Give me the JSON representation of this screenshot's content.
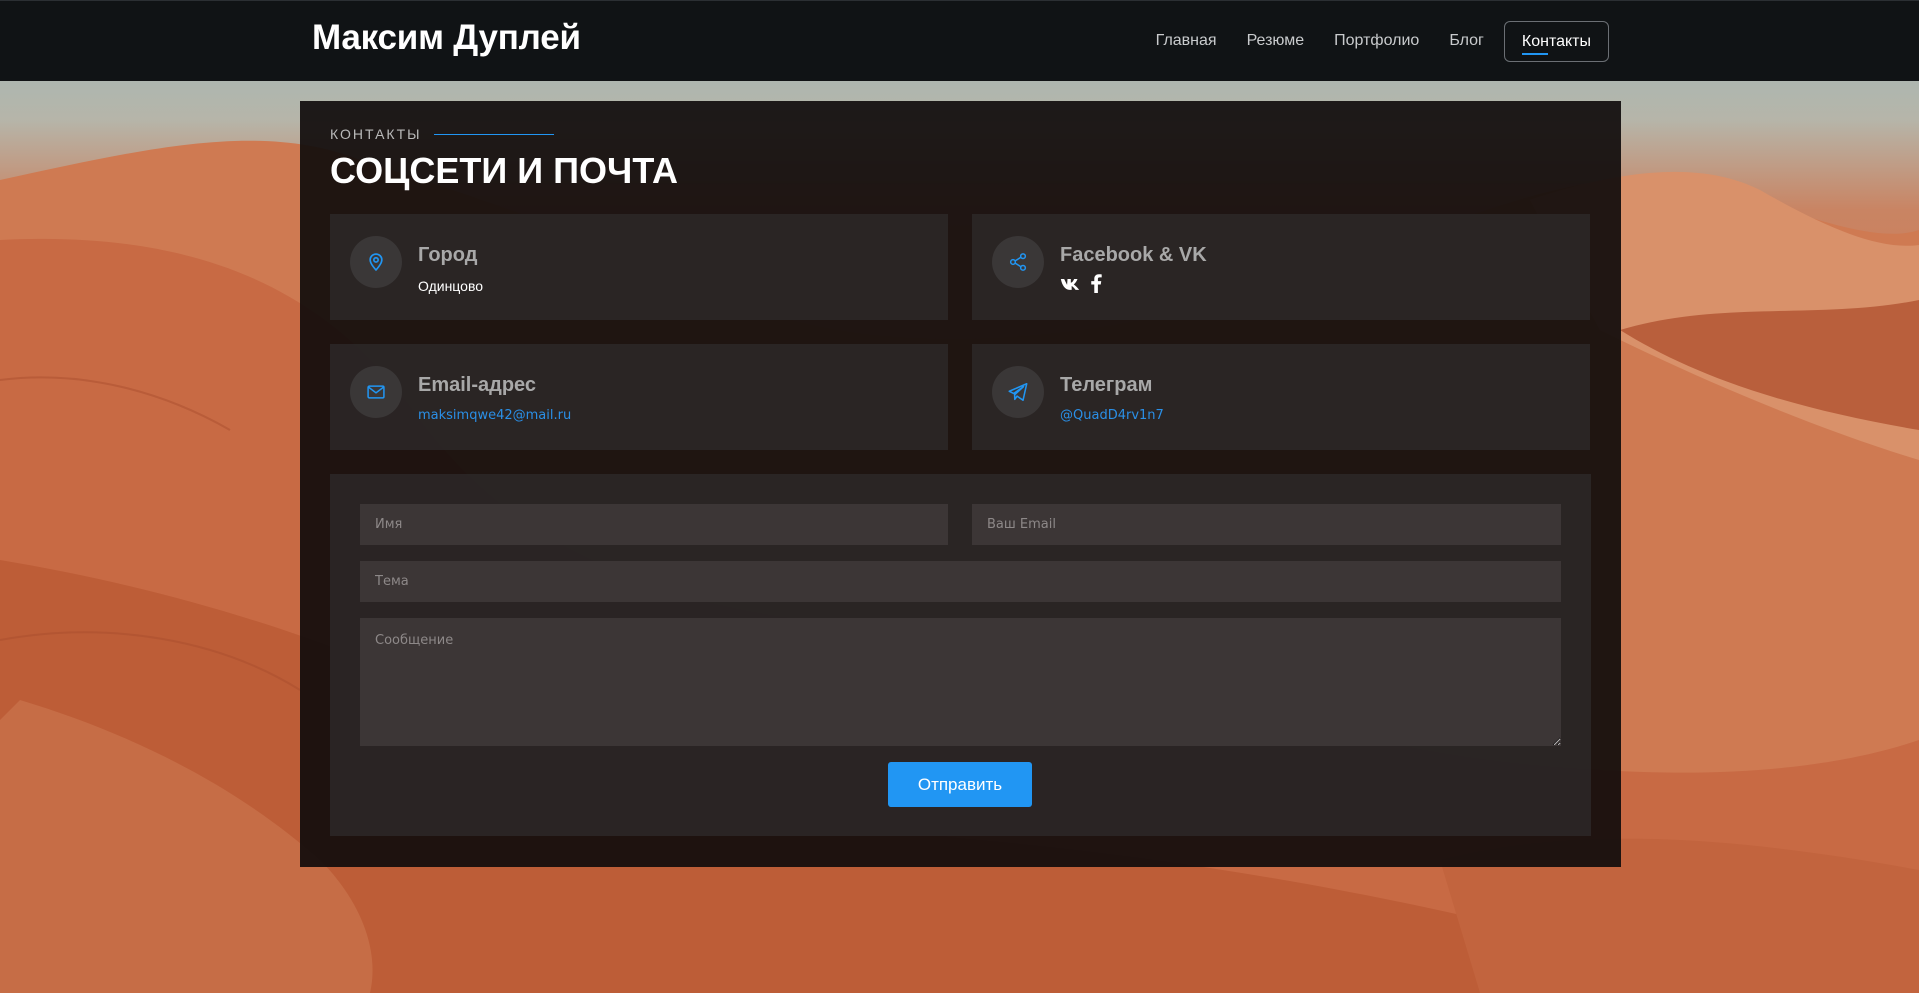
{
  "header": {
    "logo": "Максим Дуплей",
    "nav": [
      "Главная",
      "Резюме",
      "Портфолио",
      "Блог",
      "Контакты"
    ],
    "active_nav": "Контакты"
  },
  "section": {
    "label": "КОНТАКТЫ",
    "title": "СОЦСЕТИ И ПОЧТА"
  },
  "cards": {
    "city": {
      "title": "Город",
      "value": "Одинцово",
      "icon": "map-pin-icon"
    },
    "social": {
      "title": "Facebook & VK",
      "icon": "share-icon",
      "links": [
        "vk-icon",
        "facebook-icon"
      ]
    },
    "email": {
      "title": "Email-адрес",
      "value": "maksimqwe42@mail.ru",
      "icon": "mail-icon"
    },
    "telegram": {
      "title": "Телеграм",
      "value": "@QuadD4rv1n7",
      "icon": "telegram-icon"
    }
  },
  "form": {
    "name_placeholder": "Имя",
    "email_placeholder": "Ваш Email",
    "subject_placeholder": "Тема",
    "message_placeholder": "Сообщение",
    "submit_label": "Отправить"
  },
  "colors": {
    "accent": "#2196f3",
    "header_bg": "#101315",
    "panel_bg": "#100c0c",
    "card_bg": "#2d2828"
  }
}
